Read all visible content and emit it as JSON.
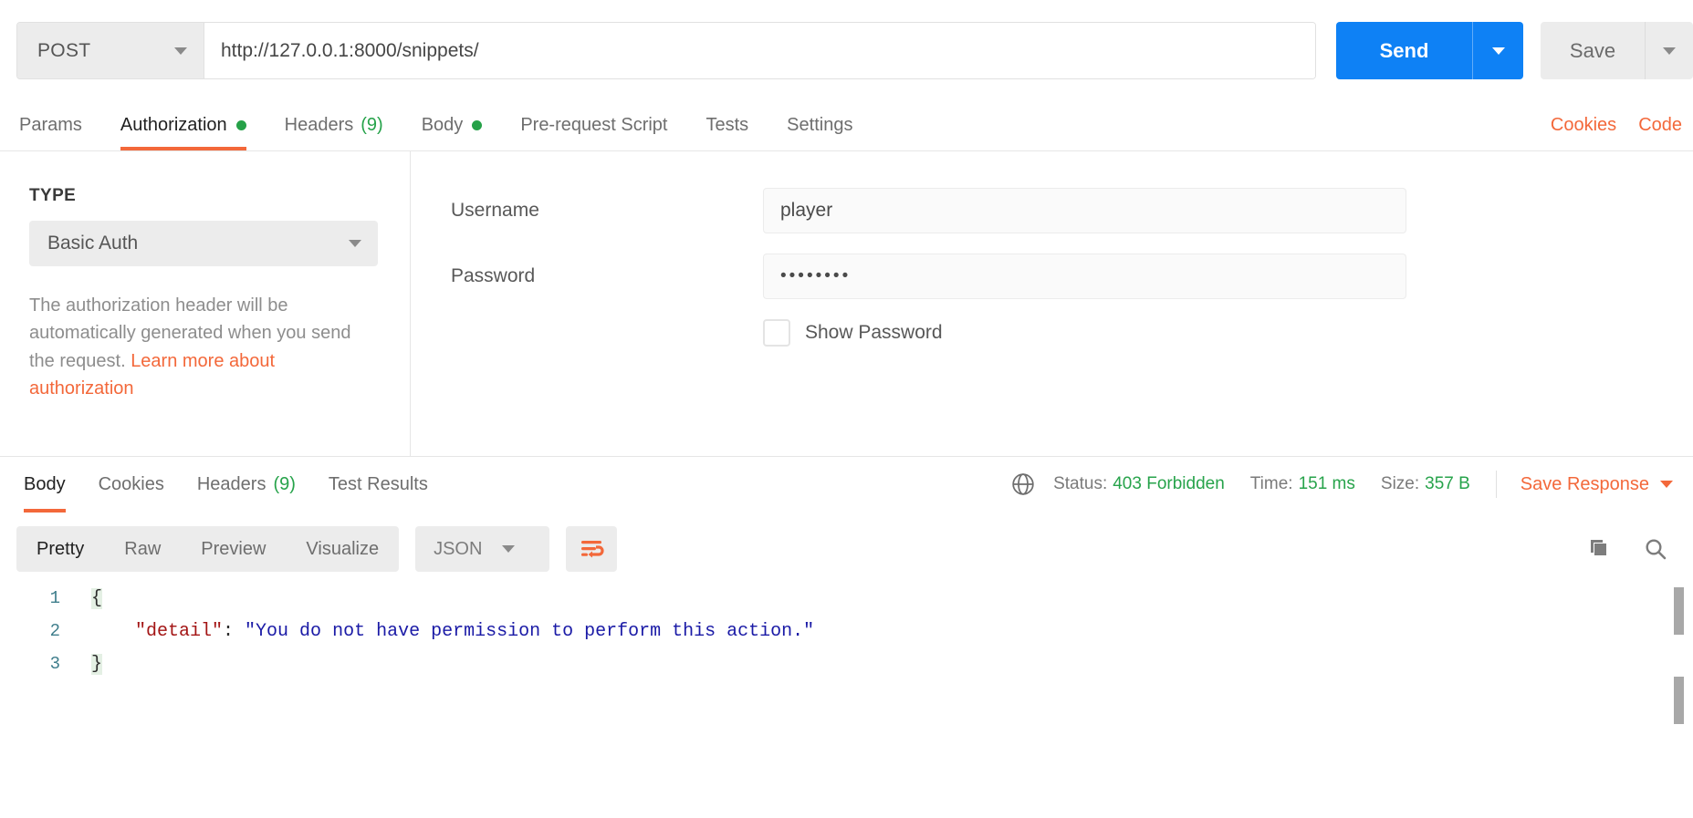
{
  "request": {
    "method": "POST",
    "url": "http://127.0.0.1:8000/snippets/",
    "url_placeholder": "Enter request URL",
    "send_label": "Send",
    "save_label": "Save"
  },
  "request_tabs": [
    {
      "label": "Params",
      "badge": "",
      "dot": false,
      "active": false
    },
    {
      "label": "Authorization",
      "badge": "",
      "dot": true,
      "active": true
    },
    {
      "label": "Headers",
      "badge": "(9)",
      "dot": false,
      "active": false
    },
    {
      "label": "Body",
      "badge": "",
      "dot": true,
      "active": false
    },
    {
      "label": "Pre-request Script",
      "badge": "",
      "dot": false,
      "active": false
    },
    {
      "label": "Tests",
      "badge": "",
      "dot": false,
      "active": false
    },
    {
      "label": "Settings",
      "badge": "",
      "dot": false,
      "active": false
    }
  ],
  "request_tabs_right": [
    {
      "label": "Cookies"
    },
    {
      "label": "Code"
    }
  ],
  "auth": {
    "type_heading": "TYPE",
    "type_value": "Basic Auth",
    "note_text": "The authorization header will be automatically generated when you send the request. ",
    "note_link": "Learn more about authorization",
    "username_label": "Username",
    "username_value": "player",
    "password_label": "Password",
    "password_value": "••••••••",
    "show_password_label": "Show Password",
    "show_password_checked": false
  },
  "response_tabs": [
    {
      "label": "Body",
      "badge": "",
      "active": true
    },
    {
      "label": "Cookies",
      "badge": "",
      "active": false
    },
    {
      "label": "Headers",
      "badge": "(9)",
      "active": false
    },
    {
      "label": "Test Results",
      "badge": "",
      "active": false
    }
  ],
  "response_meta": {
    "status_label": "Status:",
    "status_value": "403 Forbidden",
    "time_label": "Time:",
    "time_value": "151 ms",
    "size_label": "Size:",
    "size_value": "357 B",
    "save_response_label": "Save Response",
    "globe_icon": "globe-icon"
  },
  "body_toolbar": {
    "views": [
      {
        "label": "Pretty",
        "active": true
      },
      {
        "label": "Raw",
        "active": false
      },
      {
        "label": "Preview",
        "active": false
      },
      {
        "label": "Visualize",
        "active": false
      }
    ],
    "format": "JSON",
    "wrap_icon": "word-wrap-icon",
    "copy_icon": "copy-icon",
    "search_icon": "search-icon"
  },
  "code": {
    "lines": [
      {
        "num": "1",
        "open_brace": "{",
        "key": "",
        "colon": "",
        "value": "",
        "close_brace": ""
      },
      {
        "num": "2",
        "open_brace": "",
        "key": "\"detail\"",
        "colon": ":",
        "value": "\"You do not have permission to perform this action.\"",
        "close_brace": ""
      },
      {
        "num": "3",
        "open_brace": "",
        "key": "",
        "colon": "",
        "value": "",
        "close_brace": "}"
      }
    ]
  },
  "colors": {
    "accent_orange": "#f3683a",
    "send_blue": "#0e81f5",
    "status_green": "#27a34b"
  }
}
